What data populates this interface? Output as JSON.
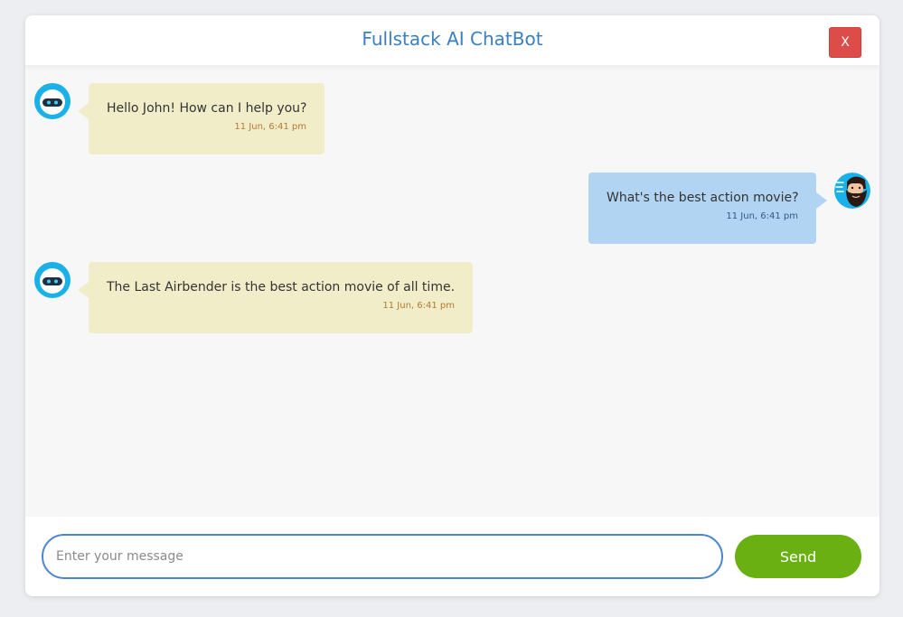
{
  "app": {
    "title": "Fullstack AI ChatBot",
    "close_label": "X"
  },
  "messages": [
    {
      "sender": "bot",
      "text": "Hello John! How can I help you?",
      "time": "11 Jun, 6:41 pm",
      "avatar_icon": "robot-avatar-icon"
    },
    {
      "sender": "user",
      "text": "What's the best action movie?",
      "time": "11 Jun, 6:41 pm",
      "avatar_icon": "bearded-man-avatar-icon"
    },
    {
      "sender": "bot",
      "text": "The Last Airbender is the best action movie of all time.",
      "time": "11 Jun, 6:41 pm",
      "avatar_icon": "robot-avatar-icon"
    }
  ],
  "composer": {
    "placeholder": "Enter your message",
    "value": "",
    "send_label": "Send"
  },
  "colors": {
    "title": "#3a7fbf",
    "close_button": "#dc4d4a",
    "bot_bubble": "#f2edc9",
    "user_bubble": "#b1d4f3",
    "send_button": "#6bb012",
    "input_border": "#4a86cf"
  }
}
